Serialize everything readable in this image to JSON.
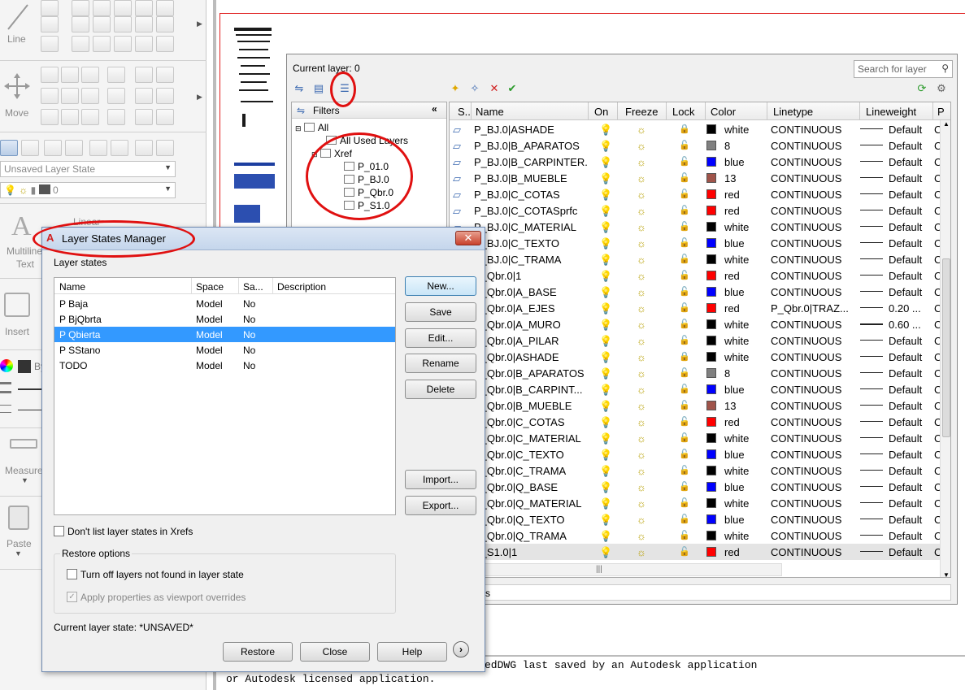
{
  "ribbon": {
    "line_label": "Line",
    "move_label": "Move",
    "layer_state_combo": "Unsaved Layer State",
    "layer_combo_value": "0",
    "linear_label": "Linear",
    "multiline_text_label": "Multiline",
    "text_label": "Text",
    "insert_label": "Insert",
    "by_label": "By",
    "measure_label": "Measure",
    "paste_label": "Paste"
  },
  "layer_palette": {
    "current_layer": "Current layer: 0",
    "search_placeholder": "Search for layer",
    "filters_label": "Filters",
    "tree": {
      "all": "All",
      "all_used": "All Used Layers",
      "xref": "Xref",
      "children": [
        "P_01.0",
        "P_BJ.0",
        "P_Qbr.0",
        "P_S1.0"
      ]
    },
    "columns": [
      "S..",
      "Name",
      "On",
      "Freeze",
      "Lock",
      "Color",
      "Linetype",
      "Lineweight",
      "P"
    ],
    "rows": [
      {
        "name": "P_BJ.0|ASHADE",
        "on_icon": "bulb-on",
        "lock_icon": "lock-closed",
        "color": "white",
        "swatch": "#000000",
        "linetype": "CONTINUOUS",
        "lineweight": "Default",
        "p": "C"
      },
      {
        "name": "P_BJ.0|B_APARATOS",
        "on_icon": "bulb-on",
        "lock_icon": "lock-open",
        "color": "8",
        "swatch": "#808080",
        "linetype": "CONTINUOUS",
        "lineweight": "Default",
        "p": "C"
      },
      {
        "name": "P_BJ.0|B_CARPINTER...",
        "on_icon": "bulb-on",
        "lock_icon": "lock-open",
        "color": "blue",
        "swatch": "#0000ff",
        "linetype": "CONTINUOUS",
        "lineweight": "Default",
        "p": "C"
      },
      {
        "name": "P_BJ.0|B_MUEBLE",
        "on_icon": "bulb-on",
        "lock_icon": "lock-open",
        "color": "13",
        "swatch": "#a0544a",
        "linetype": "CONTINUOUS",
        "lineweight": "Default",
        "p": "C"
      },
      {
        "name": "P_BJ.0|C_COTAS",
        "on_icon": "bulb-on",
        "lock_icon": "lock-open",
        "color": "red",
        "swatch": "#ff0000",
        "linetype": "CONTINUOUS",
        "lineweight": "Default",
        "p": "C"
      },
      {
        "name": "P_BJ.0|C_COTASprfc",
        "on_icon": "bulb-off",
        "lock_icon": "lock-open",
        "color": "red",
        "swatch": "#ff0000",
        "linetype": "CONTINUOUS",
        "lineweight": "Default",
        "p": "C"
      },
      {
        "name": "P_BJ.0|C_MATERIAL",
        "on_icon": "bulb-on",
        "lock_icon": "lock-open",
        "color": "white",
        "swatch": "#000000",
        "linetype": "CONTINUOUS",
        "lineweight": "Default",
        "p": "C"
      },
      {
        "name": "P_BJ.0|C_TEXTO",
        "on_icon": "bulb-on",
        "lock_icon": "lock-open",
        "color": "blue",
        "swatch": "#0000ff",
        "linetype": "CONTINUOUS",
        "lineweight": "Default",
        "p": "C"
      },
      {
        "name": "P_BJ.0|C_TRAMA",
        "on_icon": "bulb-on",
        "lock_icon": "lock-open",
        "color": "white",
        "swatch": "#000000",
        "linetype": "CONTINUOUS",
        "lineweight": "Default",
        "p": "C"
      },
      {
        "name": "P_Qbr.0|1",
        "on_icon": "bulb-on",
        "lock_icon": "lock-open",
        "color": "red",
        "swatch": "#ff0000",
        "linetype": "CONTINUOUS",
        "lineweight": "Default",
        "p": "C"
      },
      {
        "name": "P_Qbr.0|A_BASE",
        "on_icon": "bulb-on",
        "lock_icon": "lock-open",
        "color": "blue",
        "swatch": "#0000ff",
        "linetype": "CONTINUOUS",
        "lineweight": "Default",
        "p": "C"
      },
      {
        "name": "P_Qbr.0|A_EJES",
        "on_icon": "bulb-on",
        "lock_icon": "lock-open",
        "color": "red",
        "swatch": "#ff0000",
        "linetype": "P_Qbr.0|TRAZ...",
        "lineweight": "0.20 ...",
        "p": "C"
      },
      {
        "name": "P_Qbr.0|A_MURO",
        "on_icon": "bulb-on",
        "lock_icon": "lock-open",
        "color": "white",
        "swatch": "#000000",
        "linetype": "CONTINUOUS",
        "lineweight": "0.60 ...",
        "p": "C"
      },
      {
        "name": "P_Qbr.0|A_PILAR",
        "on_icon": "bulb-on",
        "lock_icon": "lock-open",
        "color": "white",
        "swatch": "#000000",
        "linetype": "CONTINUOUS",
        "lineweight": "Default",
        "p": "C"
      },
      {
        "name": "P_Qbr.0|ASHADE",
        "on_icon": "bulb-on",
        "lock_icon": "lock-closed",
        "color": "white",
        "swatch": "#000000",
        "linetype": "CONTINUOUS",
        "lineweight": "Default",
        "p": "C"
      },
      {
        "name": "P_Qbr.0|B_APARATOS",
        "on_icon": "bulb-on",
        "lock_icon": "lock-open",
        "color": "8",
        "swatch": "#808080",
        "linetype": "CONTINUOUS",
        "lineweight": "Default",
        "p": "C"
      },
      {
        "name": "P_Qbr.0|B_CARPINT...",
        "on_icon": "bulb-on",
        "lock_icon": "lock-open",
        "color": "blue",
        "swatch": "#0000ff",
        "linetype": "CONTINUOUS",
        "lineweight": "Default",
        "p": "C"
      },
      {
        "name": "P_Qbr.0|B_MUEBLE",
        "on_icon": "bulb-on",
        "lock_icon": "lock-open",
        "color": "13",
        "swatch": "#a0544a",
        "linetype": "CONTINUOUS",
        "lineweight": "Default",
        "p": "C"
      },
      {
        "name": "P_Qbr.0|C_COTAS",
        "on_icon": "bulb-on",
        "lock_icon": "lock-open",
        "color": "red",
        "swatch": "#ff0000",
        "linetype": "CONTINUOUS",
        "lineweight": "Default",
        "p": "C"
      },
      {
        "name": "P_Qbr.0|C_MATERIAL",
        "on_icon": "bulb-on",
        "lock_icon": "lock-open",
        "color": "white",
        "swatch": "#000000",
        "linetype": "CONTINUOUS",
        "lineweight": "Default",
        "p": "C"
      },
      {
        "name": "P_Qbr.0|C_TEXTO",
        "on_icon": "bulb-on",
        "lock_icon": "lock-open",
        "color": "blue",
        "swatch": "#0000ff",
        "linetype": "CONTINUOUS",
        "lineweight": "Default",
        "p": "C"
      },
      {
        "name": "P_Qbr.0|C_TRAMA",
        "on_icon": "bulb-on",
        "lock_icon": "lock-open",
        "color": "white",
        "swatch": "#000000",
        "linetype": "CONTINUOUS",
        "lineweight": "Default",
        "p": "C"
      },
      {
        "name": "P_Qbr.0|Q_BASE",
        "on_icon": "bulb-on",
        "lock_icon": "lock-open",
        "color": "blue",
        "swatch": "#0000ff",
        "linetype": "CONTINUOUS",
        "lineweight": "Default",
        "p": "C"
      },
      {
        "name": "P_Qbr.0|Q_MATERIAL",
        "on_icon": "bulb-on",
        "lock_icon": "lock-open",
        "color": "white",
        "swatch": "#000000",
        "linetype": "CONTINUOUS",
        "lineweight": "Default",
        "p": "C"
      },
      {
        "name": "P_Qbr.0|Q_TEXTO",
        "on_icon": "bulb-on",
        "lock_icon": "lock-open",
        "color": "blue",
        "swatch": "#0000ff",
        "linetype": "CONTINUOUS",
        "lineweight": "Default",
        "p": "C"
      },
      {
        "name": "P_Qbr.0|Q_TRAMA",
        "on_icon": "bulb-on",
        "lock_icon": "lock-open",
        "color": "white",
        "swatch": "#000000",
        "linetype": "CONTINUOUS",
        "lineweight": "Default",
        "p": "C"
      },
      {
        "name": "P_S1.0|1",
        "on_icon": "bulb-on",
        "lock_icon": "lock-open",
        "color": "red",
        "swatch": "#ff0000",
        "linetype": "CONTINUOUS",
        "lineweight": "Default",
        "p": "C",
        "highlight": true
      }
    ],
    "status_text": "s"
  },
  "dialog": {
    "title": "Layer States Manager",
    "close_glyph": "✕",
    "layer_states_label": "Layer states",
    "columns": [
      "Name",
      "Space",
      "Sa...",
      "Description"
    ],
    "states": [
      {
        "name": "P Baja",
        "space": "Model",
        "saved": "No",
        "description": ""
      },
      {
        "name": "P BjQbrta",
        "space": "Model",
        "saved": "No",
        "description": ""
      },
      {
        "name": "P Qbierta",
        "space": "Model",
        "saved": "No",
        "description": "",
        "selected": true
      },
      {
        "name": "P SStano",
        "space": "Model",
        "saved": "No",
        "description": ""
      },
      {
        "name": "TODO",
        "space": "Model",
        "saved": "No",
        "description": ""
      }
    ],
    "buttons": {
      "new": "New...",
      "save": "Save",
      "edit": "Edit...",
      "rename": "Rename",
      "delete": "Delete",
      "import": "Import...",
      "export": "Export...",
      "restore": "Restore",
      "close": "Close",
      "help": "Help"
    },
    "dont_list_xrefs": "Don't list layer states in Xrefs",
    "restore_options_label": "Restore options",
    "turn_off_layers": "Turn off layers not found in layer state",
    "apply_properties": "Apply properties as viewport overrides",
    "current_state": "Current layer state: *UNSAVED*"
  },
  "command_line": {
    "line1": "edDWG last saved by an Autodesk application",
    "line2": "or Autodesk licensed application."
  },
  "colors": {
    "selection": "#3399ff",
    "annotation_red": "#e01010"
  }
}
